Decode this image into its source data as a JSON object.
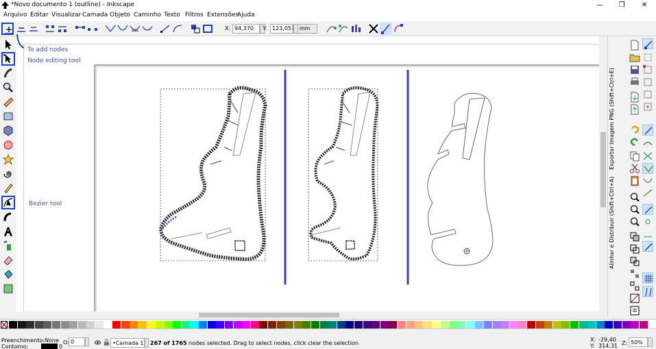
{
  "window": {
    "title": "*Novo documento 1 (outline) - Inkscape",
    "minimize": "—",
    "maximize": "❐",
    "close": "✕"
  },
  "menu": [
    "Arquivo",
    "Editar",
    "Visualizar",
    "Camada",
    "Objeto",
    "Caminho",
    "Texto",
    "Filtros",
    "Extensões",
    "Ajuda"
  ],
  "nodebar": {
    "x_label": "X:",
    "x_value": "94,370",
    "y_label": "Y:",
    "y_value": "123,057",
    "unit": "mm"
  },
  "annotations": {
    "add_nodes": "To add nodes",
    "node_tool": "Node editing tool",
    "bezier_tool": "Bezier tool"
  },
  "dock": {
    "export_png": "Exportar Imagem PNG (Shift+Ctrl+E)",
    "align": "Alinhar e Distribuir (Shift+Ctrl+A)"
  },
  "status": {
    "fill_label": "Preenchimento:",
    "fill_value": "None",
    "stroke_label": "Contorno:",
    "stroke_width": "0",
    "opacity_label": "O:",
    "opacity_value": "0",
    "layer": "•Camada 1",
    "message_count": "267 of 1765",
    "message_rest": " nodes selected. Drag to select nodes, click clear the selection",
    "cursor_x_label": "X:",
    "cursor_x": "-29,40",
    "cursor_y_label": "Y:",
    "cursor_y": "314,31",
    "zoom_label": "Z:",
    "zoom": "50%"
  },
  "colors": {
    "highlight": "#1f3fb5",
    "guide": "#3a3fbf",
    "annotation": "#3a4fc0"
  }
}
